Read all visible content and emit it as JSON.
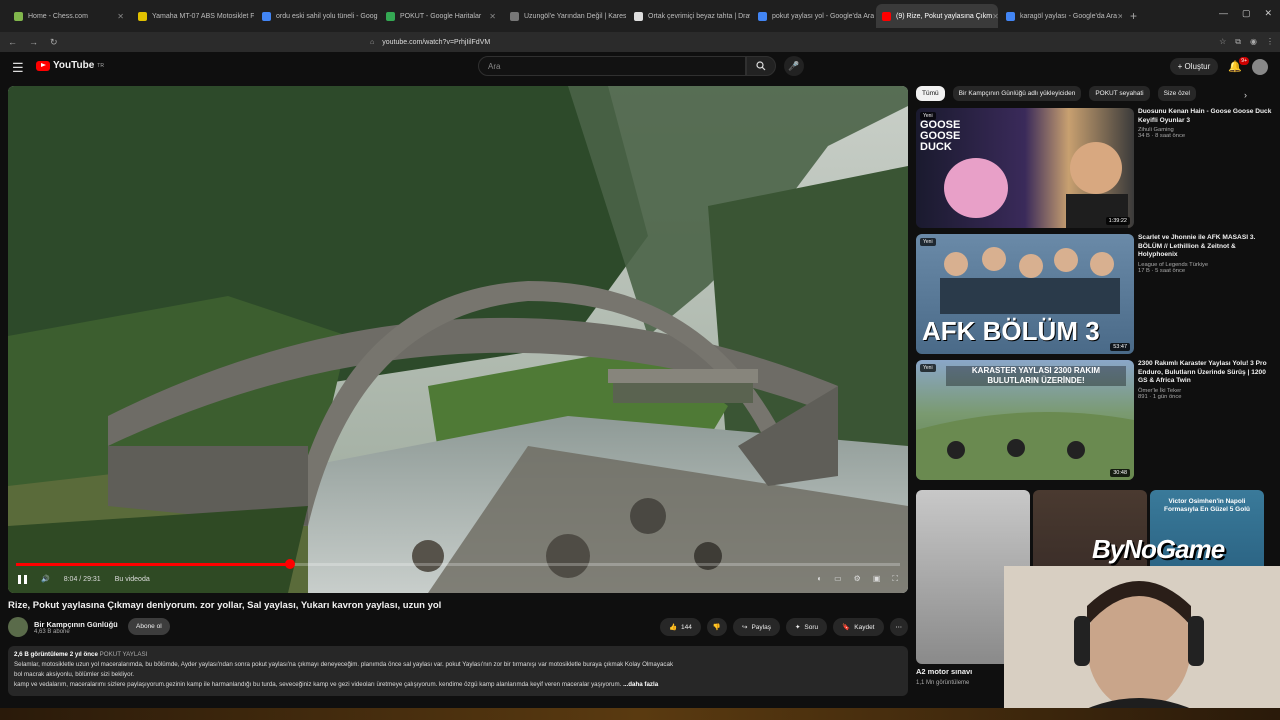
{
  "browser": {
    "tabs": [
      {
        "title": "Home - Chess.com",
        "color": "#81b64c",
        "active": false
      },
      {
        "title": "Yamaha MT-07 ABS Motosiklet Fiyatı",
        "color": "#e0c000",
        "active": false
      },
      {
        "title": "ordu eski sahil yolu tüneli - Google'da",
        "color": "#4285f4",
        "active": false
      },
      {
        "title": "POKUT - Google Haritalar",
        "color": "#34a853",
        "active": false
      },
      {
        "title": "Uzungöl'e Yarından Değil | Karesten",
        "color": "#777777",
        "active": false
      },
      {
        "title": "Ortak çevrimiçi beyaz tahta | Draw.Ch",
        "color": "#dddddd",
        "active": false
      },
      {
        "title": "pokut yaylası yol - Google'da Ara",
        "color": "#4285f4",
        "active": false
      },
      {
        "title": "(9) Rize, Pokut yaylasına Çıkm",
        "color": "#ff0000",
        "active": true
      },
      {
        "title": "karagöl yaylası - Google'da Ara",
        "color": "#4285f4",
        "active": false
      }
    ],
    "new_tab": "+",
    "url": "youtube.com/watch?v=PrhjIilFdVM",
    "nav_back": "←",
    "nav_forward": "→",
    "nav_reload": "↻"
  },
  "header": {
    "menu_icon": "☰",
    "logo_text": "YouTube",
    "logo_region": "TR",
    "search_placeholder": "Ara",
    "create_label": "+ Oluştur",
    "notification_count": "9+"
  },
  "player": {
    "current_time": "8:04",
    "duration": "29:31",
    "time_display": "8:04 / 29:31",
    "chapter_label": "Bu videoda",
    "progress_fraction": 0.31
  },
  "video": {
    "title": "Rize, Pokut yaylasına Çıkmayı deniyorum. zor yollar, Sal yaylası, Yukarı kavron yaylası, uzun yol",
    "channel_name": "Bir Kampçının Günlüğü",
    "subscribers": "4,63 B abone",
    "subscribe_label": "Abone ol",
    "likes": "144",
    "share_label": "Paylaş",
    "ask_label": "Soru",
    "save_label": "Kaydet",
    "more_label": "⋯",
    "views": "2,6 B görüntüleme",
    "age": "2 yıl önce",
    "tag": "POKUT YAYLASI",
    "description_line1": "Selamlar, motosikletle uzun yol maceralarımda, bu bölümde, Ayder yaylası'ndan sonra pokut yaylası'na çıkmayı deneyeceğim. planımda önce sal yaylası var. pokut Yaylası'nın zor bir tırmanışı var motosikletle buraya çıkmak Kolay Olmayacak",
    "description_line2": "bol macrak aksiyonlu, bölümler sizi bekliyor.",
    "description_line3": "kamp ve vedalarım, maceralarımı sizlere paylaşıyorum.gezinin kamp ile harmanlandığı bu turda, seveceğiniz  kamp ve gezi videoları  üretmeye çalışıyorum. kendime özgü  kamp alanlarımda keyif veren maceralar yaşıyorum.",
    "show_more": "...daha fazla"
  },
  "chips": [
    {
      "label": "Tümü",
      "active": true
    },
    {
      "label": "Bir Kampçının Günlüğü adlı yükleyiciden",
      "active": false
    },
    {
      "label": "POKUT seyahati",
      "active": false
    },
    {
      "label": "Size özel",
      "active": false
    }
  ],
  "recommendations": [
    {
      "title": "Duosunu Kenan Hain - Goose Goose Duck Keyifli Oyunlar 3",
      "channel": "Zihuli Gaming",
      "views": "34 B",
      "age": "8 saat önce",
      "duration": "1:39:22",
      "badge": "Yeni",
      "thumb_text": "GOOSE GOOSE DUCK"
    },
    {
      "title": "Scarlet ve Jhonnie ile AFK MASASI 3. BÖLÜM // Lethillion & Zeitnot & Holyphoenix",
      "channel": "League of Legends Türkiye",
      "views": "17 B",
      "age": "5 saat önce",
      "duration": "53:47",
      "badge": "Yeni",
      "thumb_text": "AFK BÖLÜM 3"
    },
    {
      "title": "2300 Rakımlı Karaster Yaylası Yolu! 3 Pro Enduro, Bulutların Üzerinde Sürüş | 1200 GS & Africa Twin",
      "channel": "Ömer'le İki Teker",
      "views": "891",
      "age": "1 gün önce",
      "duration": "30:48",
      "badge": "Yeni",
      "thumb_text": "KARASTER YAYLASI 2300 RAKIM BULUTLARIN ÜZERİNDE!"
    }
  ],
  "shorts": [
    {
      "title": "A2 motor sınavı",
      "views": "1,1 Mn görüntüleme"
    },
    {
      "title": "",
      "views": ""
    },
    {
      "title": "Victor Osimhen'in Napoli Formasıyla En Güzel 5 Golü",
      "views": ""
    }
  ],
  "overlay": {
    "watermark": "ByNoGame"
  }
}
